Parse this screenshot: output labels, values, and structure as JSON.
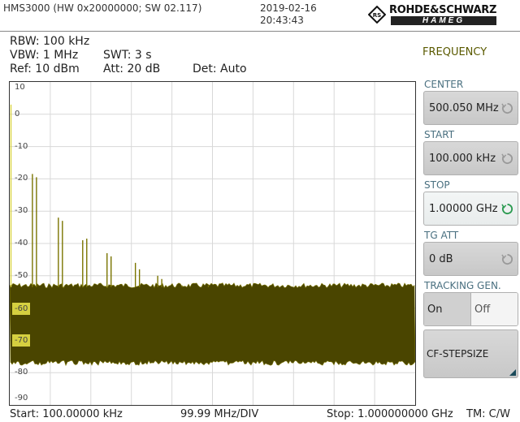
{
  "header": {
    "title": "HMS3000 (HW 0x20000000; SW 02.117)",
    "date": "2019-02-16",
    "time": "20:43:43",
    "logo_brand": "ROHDE&SCHWARZ",
    "logo_sub": "HAMEG"
  },
  "settings": {
    "rbw": "RBW: 100 kHz",
    "vbw": "VBW: 1 MHz",
    "swt": "SWT: 3 s",
    "ref": "Ref: 10 dBm",
    "att": "Att: 20 dB",
    "det": "Det: Auto"
  },
  "footer": {
    "start": "Start: 100.00000 kHz",
    "div": "99.99 MHz/DIV",
    "stop": "Stop: 1.000000000 GHz",
    "tm": "TM: C/W"
  },
  "menu": {
    "title": "FREQUENCY",
    "center_label": "CENTER",
    "center_value": "500.050 MHz",
    "start_label": "START",
    "start_value": "100.000 kHz",
    "stop_label": "STOP",
    "stop_value": "1.00000 GHz",
    "tgatt_label": "TG ATT",
    "tgatt_value": "0 dB",
    "tracking_label": "TRACKING GEN.",
    "tracking_on": "On",
    "tracking_off": "Off",
    "cf_stepsize": "CF-STEPSIZE"
  },
  "colors": {
    "trace": "#4a4500",
    "trace_edge": "#7a7400",
    "marker_line": "#d6d040",
    "grid": "#d8d8d8",
    "highlight": "#d6d040",
    "active_knob": "#2a9a50"
  },
  "chart_data": {
    "type": "line",
    "x_unit": "MHz",
    "y_unit": "dBm",
    "xlim": [
      0.1,
      1000
    ],
    "ylim": [
      -90,
      10
    ],
    "y_ticks": [
      "10",
      "0",
      "-10",
      "-20",
      "-30",
      "-40",
      "-50",
      "-60",
      "-70",
      "-80",
      "-90"
    ],
    "noise_floor": {
      "top": -53,
      "bottom": -77
    },
    "spurs": [
      {
        "x": 0.1,
        "y": 3
      },
      {
        "x": 56,
        "y": -18.5
      },
      {
        "x": 66,
        "y": -19.5
      },
      {
        "x": 120,
        "y": -32
      },
      {
        "x": 130,
        "y": -33
      },
      {
        "x": 180,
        "y": -39
      },
      {
        "x": 190,
        "y": -38.5
      },
      {
        "x": 240,
        "y": -43
      },
      {
        "x": 250,
        "y": -44
      },
      {
        "x": 310,
        "y": -46
      },
      {
        "x": 320,
        "y": -48
      },
      {
        "x": 365,
        "y": -50
      },
      {
        "x": 375,
        "y": -51
      },
      {
        "x": 425,
        "y": -53
      },
      {
        "x": 490,
        "y": -53
      }
    ]
  }
}
